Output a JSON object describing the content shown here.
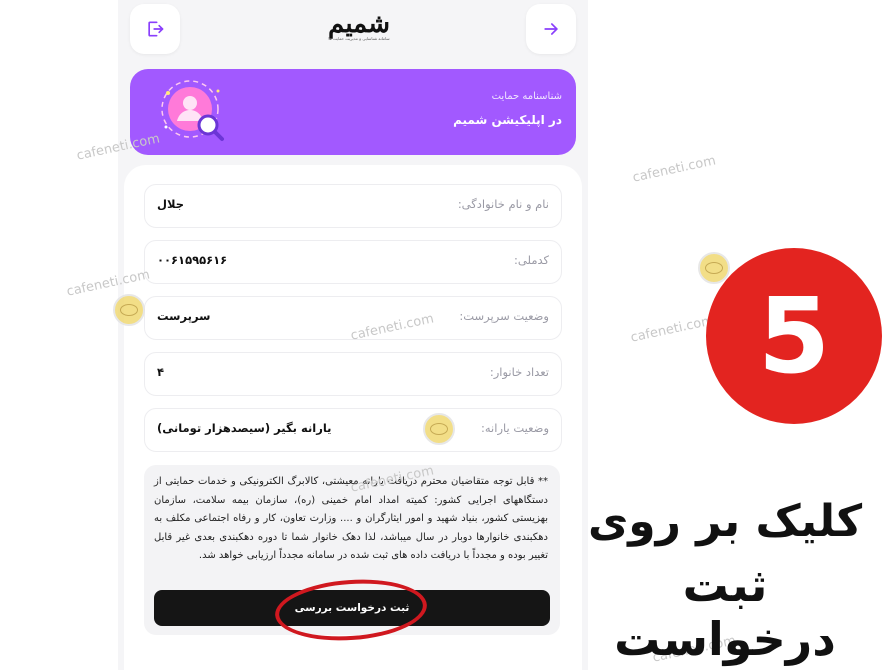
{
  "header": {
    "logo_text": "شمیم",
    "logo_subtitle": "سامانه شناسایی و مدیریت حمایت ها",
    "logout_icon": "logout-icon",
    "forward_icon": "arrow-right-icon"
  },
  "banner": {
    "subtitle": "شناسنامه حمایت",
    "title": "در اپلیکیشن شمیم",
    "icon": "user-search-icon",
    "color": "#a259ff"
  },
  "fields": [
    {
      "label": "نام و نام خانوادگی:",
      "value": "جلال"
    },
    {
      "label": "کدملی:",
      "value": "۰۰۶۱۵۹۵۶۱۶"
    },
    {
      "label": "وضعیت سرپرست:",
      "value": "سرپرست"
    },
    {
      "label": "تعداد خانوار:",
      "value": "۴"
    },
    {
      "label": "وضعیت یارانه:",
      "value": "یارانه بگیر (سیصدهزار تومانی)"
    }
  ],
  "notice": {
    "text": "** قابل توجه متقاضیان محترم دریافت یارانه معیشتی، کالابرگ الکترونیکی و خدمات حمایتی از دستگاههای اجرایی کشور: کمیته امداد امام خمینی (ره)، سازمان بیمه سلامت، سازمان بهزیستی کشور، بنیاد شهید و امور ایثارگران و .... وزارت تعاون، کار و رفاه اجتماعی مکلف به دهکبندی خانوارها دوبار در سال میباشد، لذا دهک خانوار شما تا دوره دهکبندی بعدی غیر قابل تغییر بوده و مجدداً با دریافت داده های ثبت شده در سامانه مجدداً ارزیابی خواهد شد."
  },
  "submit_button": {
    "label": "ثبت درخواست بررسی"
  },
  "watermark": "cafeneti.com",
  "overlay": {
    "step_number": "5",
    "instruction_line1": "کلیک بر روی",
    "instruction_line2": "ثبت درخواست",
    "badge_color": "#e32420",
    "highlight_color": "#d0181f"
  }
}
